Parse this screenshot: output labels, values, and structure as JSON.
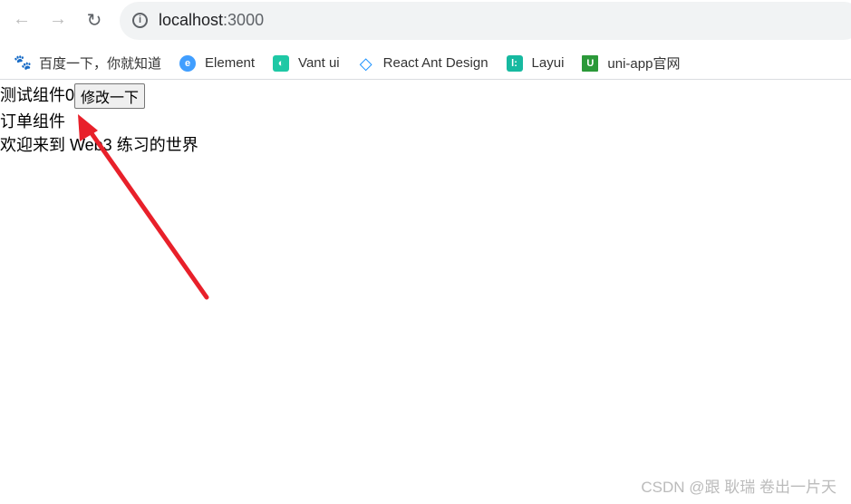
{
  "browser": {
    "url_host": "localhost",
    "url_port": ":3000",
    "bookmarks": [
      {
        "label": "百度一下，你就知道",
        "icon": "baidu-icon",
        "color": "#2932e1"
      },
      {
        "label": "Element",
        "icon": "element-icon",
        "color": "#409eff"
      },
      {
        "label": "Vant ui",
        "icon": "vant-icon",
        "color": "#1fc8a5"
      },
      {
        "label": "React Ant Design",
        "icon": "antd-icon",
        "color": "#1890ff"
      },
      {
        "label": "Layui",
        "icon": "layui-icon",
        "color": "#16b9a0"
      },
      {
        "label": "uni-app官网",
        "icon": "uniapp-icon",
        "color": "#2b9939"
      }
    ]
  },
  "page": {
    "test_component": "测试组件0",
    "modify_button": "修改一下",
    "order_component": "订单组件",
    "welcome": "欢迎来到 Web3 练习的世界"
  },
  "annotation": {
    "arrow_color": "#e8202a"
  },
  "watermark": "CSDN @跟 耿瑞 卷出一片天"
}
